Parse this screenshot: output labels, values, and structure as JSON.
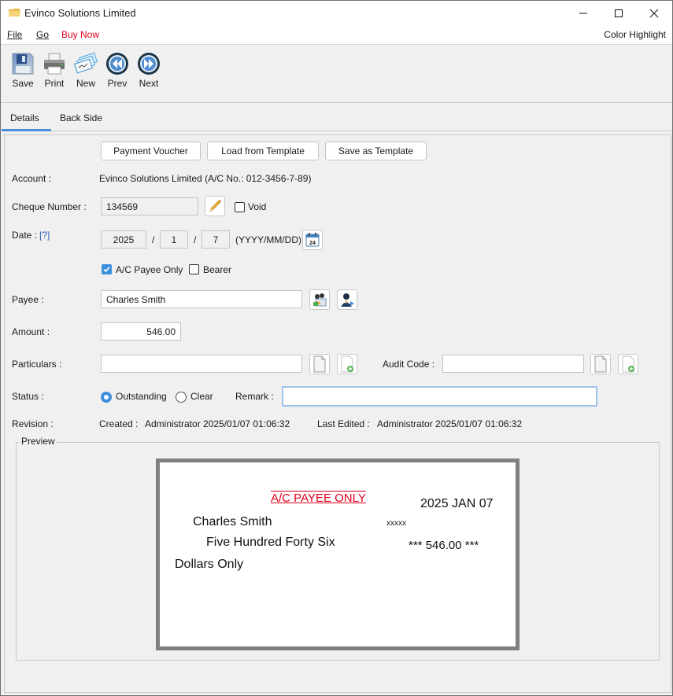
{
  "window": {
    "title": "Evinco Solutions Limited",
    "controls": {
      "minimize": "minimize",
      "maximize": "maximize",
      "close": "close"
    }
  },
  "menu": {
    "items": [
      {
        "label": "File",
        "mnemonic_underline": true
      },
      {
        "label": "Go",
        "mnemonic_underline": true
      },
      {
        "label": "Buy Now",
        "color": "#e0001b"
      }
    ],
    "right_label": "Color Highlight"
  },
  "toolbar": {
    "items": [
      {
        "label": "Save",
        "icon": "floppy-disk-icon"
      },
      {
        "label": "Print",
        "icon": "printer-icon"
      },
      {
        "label": "New",
        "icon": "new-cheque-icon"
      },
      {
        "label": "Prev",
        "icon": "rewind-icon"
      },
      {
        "label": "Next",
        "icon": "fast-forward-icon"
      }
    ]
  },
  "tabs": [
    {
      "label": "Details",
      "active": true
    },
    {
      "label": "Back Side",
      "active": false
    }
  ],
  "form": {
    "buttons": {
      "payment_voucher": "Payment Voucher",
      "load_template": "Load from Template",
      "save_template": "Save as Template"
    },
    "account": {
      "label": "Account :",
      "value": "Evinco Solutions Limited (A/C No.: 012-3456-7-89)"
    },
    "cheque_number": {
      "label": "Cheque Number :",
      "value": "134569",
      "void_label": "Void",
      "void_checked": false
    },
    "date": {
      "label": "Date :",
      "help": "[?]",
      "year": "2025",
      "month": "1",
      "day": "7",
      "separator": "/",
      "format_hint": "(YYYY/MM/DD)",
      "calendar_day": "24"
    },
    "options": {
      "ac_payee_label": "A/C Payee Only",
      "ac_payee_checked": true,
      "bearer_label": "Bearer",
      "bearer_checked": false
    },
    "payee": {
      "label": "Payee :",
      "value": "Charles Smith"
    },
    "amount": {
      "label": "Amount :",
      "value": "546.00"
    },
    "particulars": {
      "label": "Particulars :",
      "value": ""
    },
    "audit_code": {
      "label": "Audit Code :",
      "value": ""
    },
    "status": {
      "label": "Status :",
      "options": [
        "Outstanding",
        "Clear"
      ],
      "selected": "Outstanding"
    },
    "remark": {
      "label": "Remark :",
      "value": ""
    },
    "revision": {
      "label": "Revision :",
      "created_label": "Created :",
      "created_value": "Administrator 2025/01/07 01:06:32",
      "edited_label": "Last Edited :",
      "edited_value": "Administrator 2025/01/07 01:06:32"
    }
  },
  "preview": {
    "title": "Preview",
    "cheque": {
      "crossing": "A/C PAYEE ONLY",
      "crossing_color": "#e0001b",
      "date": "2025 JAN 07",
      "payee": "Charles Smith",
      "mask": "xxxxx",
      "amount_words": "Five Hundred Forty Six",
      "amount_figures": "*** 546.00 ***",
      "suffix": "Dollars Only"
    }
  },
  "colors": {
    "accent": "#3c8fdd",
    "tab_indicator": "#4a90d9",
    "buy_now": "#e0001b"
  }
}
